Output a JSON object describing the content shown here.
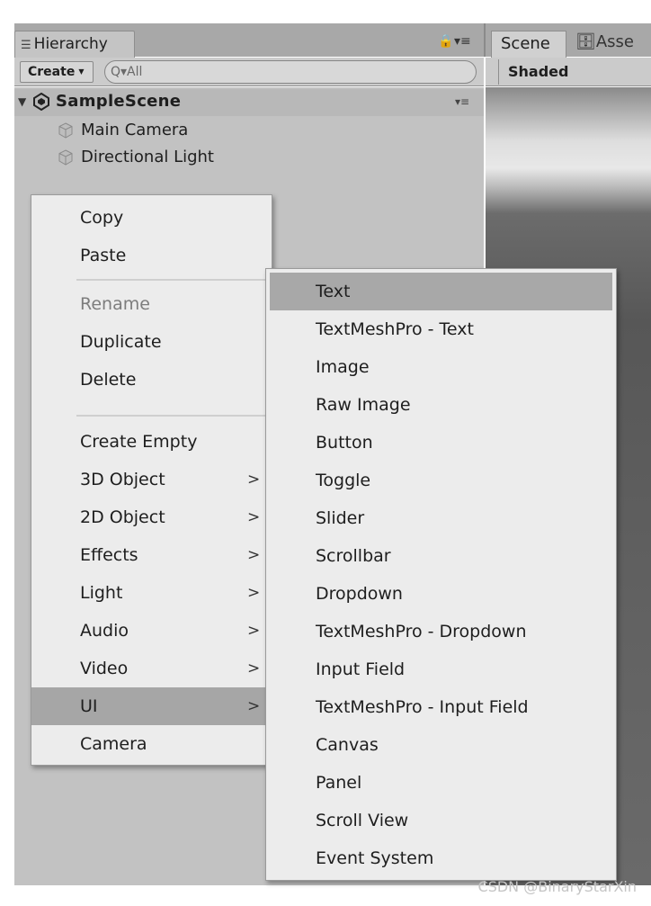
{
  "hierarchy": {
    "tab_label": "Hierarchy",
    "create_label": "Create",
    "search_placeholder": "All",
    "scene_name": "SampleScene",
    "objects": [
      "Main Camera",
      "Directional Light"
    ]
  },
  "scene_panel": {
    "tab_label": "Scene",
    "asset_tab_label": "Asse",
    "shading_mode": "Shaded"
  },
  "context_menu": {
    "items": [
      {
        "label": "Copy",
        "enabled": true
      },
      {
        "label": "Paste",
        "enabled": true
      },
      {
        "label": "Rename",
        "enabled": false
      },
      {
        "label": "Duplicate",
        "enabled": true
      },
      {
        "label": "Delete",
        "enabled": true
      },
      {
        "label": "Create Empty",
        "enabled": true
      },
      {
        "label": "3D Object",
        "submenu": true
      },
      {
        "label": "2D Object",
        "submenu": true
      },
      {
        "label": "Effects",
        "submenu": true
      },
      {
        "label": "Light",
        "submenu": true
      },
      {
        "label": "Audio",
        "submenu": true
      },
      {
        "label": "Video",
        "submenu": true
      },
      {
        "label": "UI",
        "submenu": true,
        "highlighted": true
      },
      {
        "label": "Camera",
        "enabled": true
      }
    ],
    "submenu_arrow": ">"
  },
  "ui_submenu": {
    "items": [
      {
        "label": "Text",
        "highlighted": true
      },
      {
        "label": "TextMeshPro - Text"
      },
      {
        "label": "Image"
      },
      {
        "label": "Raw Image"
      },
      {
        "label": "Button"
      },
      {
        "label": "Toggle"
      },
      {
        "label": "Slider"
      },
      {
        "label": "Scrollbar"
      },
      {
        "label": "Dropdown"
      },
      {
        "label": "TextMeshPro - Dropdown"
      },
      {
        "label": "Input Field"
      },
      {
        "label": "TextMeshPro - Input Field"
      },
      {
        "label": "Canvas"
      },
      {
        "label": "Panel"
      },
      {
        "label": "Scroll View"
      },
      {
        "label": "Event System"
      }
    ]
  },
  "watermark": "CSDN @BinaryStarXin",
  "colors": {
    "panel": "#c2c2c2",
    "menu_bg": "#ececec",
    "highlight": "#a6a6a6",
    "disabled_text": "#7d7d7d"
  }
}
